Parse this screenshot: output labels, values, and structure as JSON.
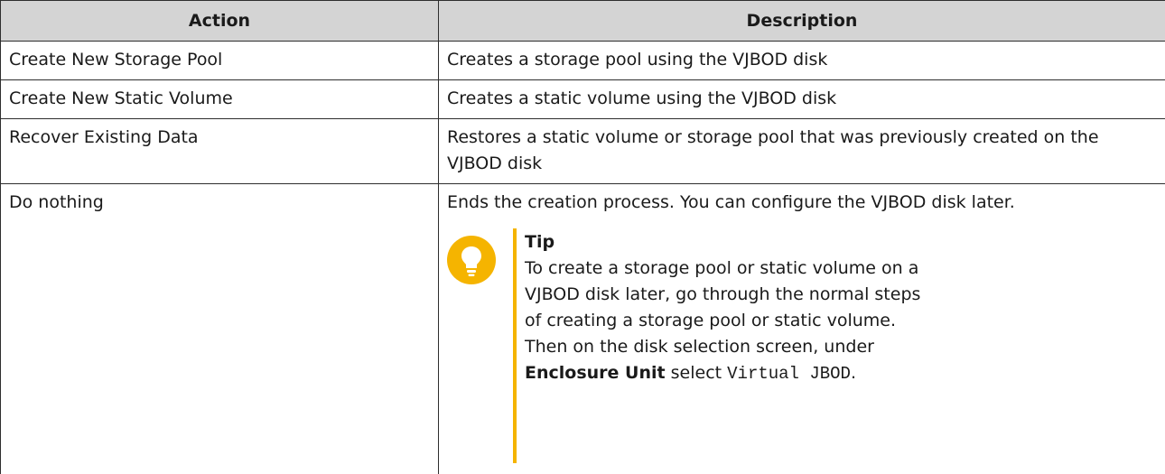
{
  "table": {
    "headers": {
      "action": "Action",
      "description": "Description"
    },
    "rows": [
      {
        "action": "Create New Storage Pool",
        "description": "Creates a storage pool using the VJBOD disk"
      },
      {
        "action": "Create New Static Volume",
        "description": "Creates a static volume using the VJBOD disk"
      },
      {
        "action": "Recover Existing Data",
        "description": "Restores a static volume or storage pool that was previously created on the VJBOD disk"
      },
      {
        "action": "Do nothing",
        "description": "Ends the creation process. You can configure the VJBOD disk later."
      }
    ]
  },
  "tip": {
    "icon": "lightbulb-icon",
    "icon_color": "#f5b400",
    "title": "Tip",
    "text_1": "To create a storage pool or static volume on a VJBOD disk later, go through the normal steps of creating a storage pool or static volume. Then on the disk selection screen, under",
    "bold": "Enclosure Unit",
    "text_2": "select",
    "code": "Virtual JBOD",
    "text_3": "."
  }
}
